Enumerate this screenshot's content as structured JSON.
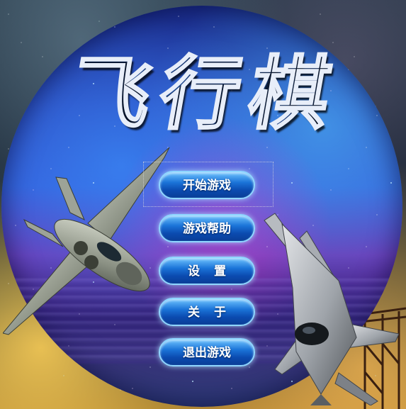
{
  "game": {
    "title": "飞行棋"
  },
  "menu": {
    "items": [
      {
        "label": "开始游戏",
        "selected": true
      },
      {
        "label": "游戏帮助",
        "selected": false
      },
      {
        "label": "设置",
        "selected": false
      },
      {
        "label": "关于",
        "selected": false
      },
      {
        "label": "退出游戏",
        "selected": false
      }
    ]
  },
  "colors": {
    "button_top": "#6fc4ff",
    "button_bottom": "#0a3e97",
    "button_border": "#8fd6ff",
    "title_fill": "#1d3f96",
    "title_stroke": "#e8eef9",
    "disc_base": "#2c49c0",
    "nebula_pink": "#d23cc8"
  },
  "icons": [
    "fighter-jet-left",
    "fighter-jet-right",
    "pier"
  ]
}
